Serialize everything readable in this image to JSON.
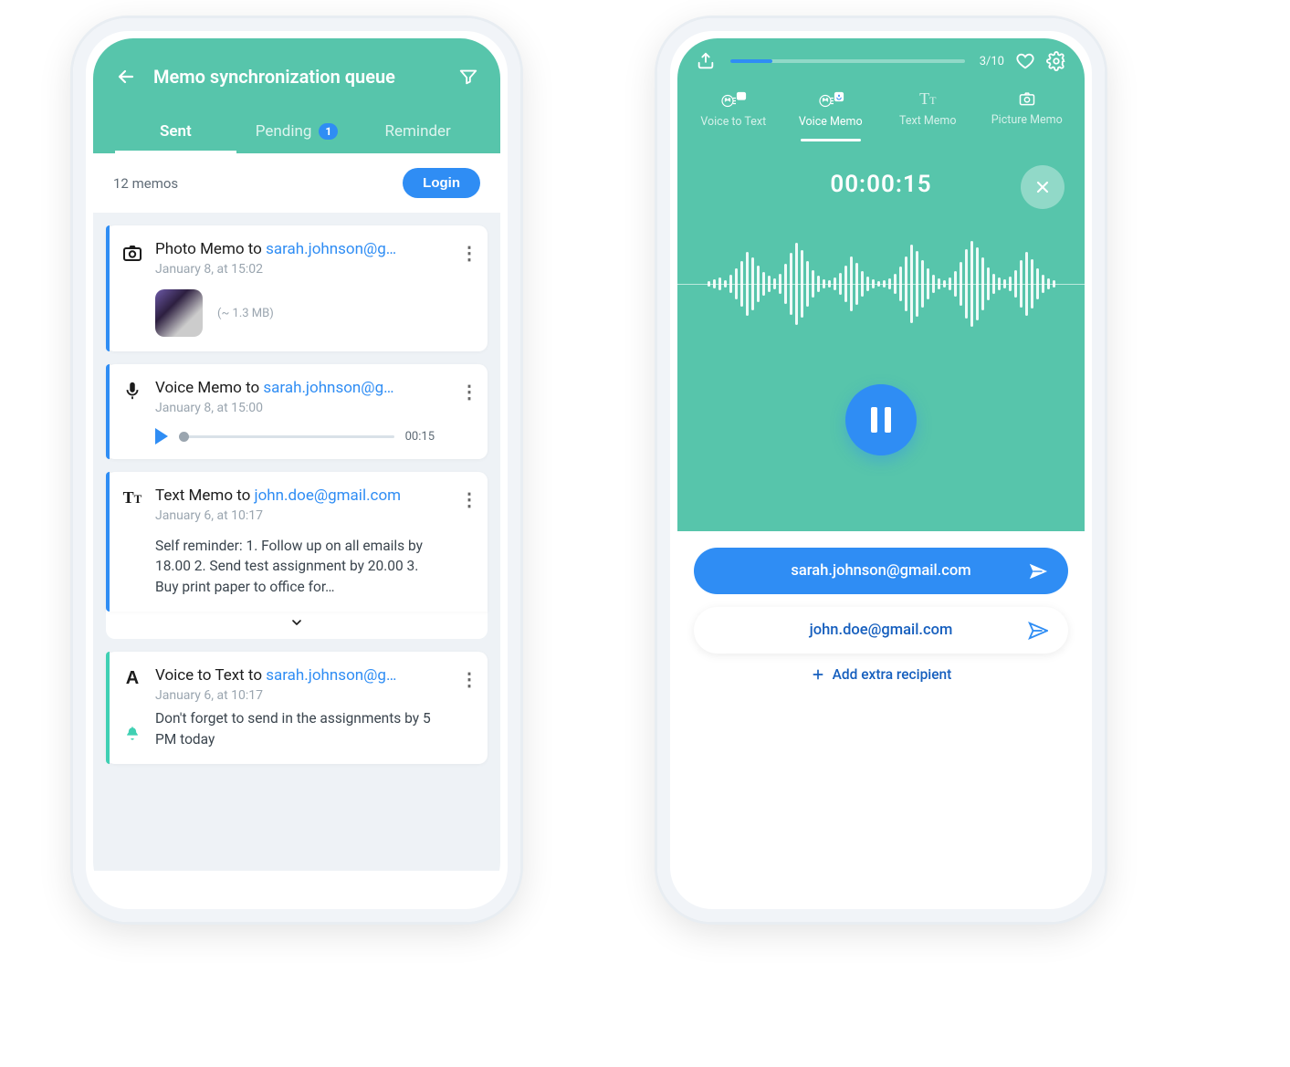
{
  "left": {
    "title": "Memo synchronization queue",
    "tabs": {
      "sent": "Sent",
      "pending": "Pending",
      "pending_badge": "1",
      "reminder": "Reminder"
    },
    "subbar": {
      "count": "12 memos",
      "login": "Login"
    },
    "memos": [
      {
        "stripe": "blue",
        "kind_label": "Photo Memo to ",
        "recipient": "sarah.johnson@g…",
        "date": "January 8, at 15:02",
        "size": "(~ 1.3 MB)"
      },
      {
        "stripe": "blue",
        "kind_label": "Voice Memo to ",
        "recipient": "sarah.johnson@g…",
        "date": "January 8, at 15:00",
        "audio_duration": "00:15"
      },
      {
        "stripe": "blue",
        "kind_label": "Text Memo to ",
        "recipient": "john.doe@gmail.com",
        "date": "January 6, at 10:17",
        "text": "Self reminder: 1. Follow up on all emails by 18.00 2. Send test assignment by 20.00 3. Buy print paper to office for…"
      },
      {
        "stripe": "teal",
        "kind_label": "Voice to Text to ",
        "recipient": "sarah.johnson@g…",
        "date": "January 6, at 10:17",
        "reminder_text": "Don't forget to send in the assignments by 5 PM today"
      }
    ]
  },
  "right": {
    "progress_label": "3/10",
    "tabs": {
      "voice_to_text": "Voice to Text",
      "voice_memo": "Voice Memo",
      "text_memo": "Text Memo",
      "picture_memo": "Picture Memo"
    },
    "timer": "00:00:15",
    "recipients": [
      {
        "email": "sarah.johnson@gmail.com",
        "primary": true
      },
      {
        "email": "john.doe@gmail.com",
        "primary": false
      }
    ],
    "add_recipient": "Add extra recipient"
  },
  "colors": {
    "teal": "#57c5ab",
    "blue": "#2f8df4"
  }
}
